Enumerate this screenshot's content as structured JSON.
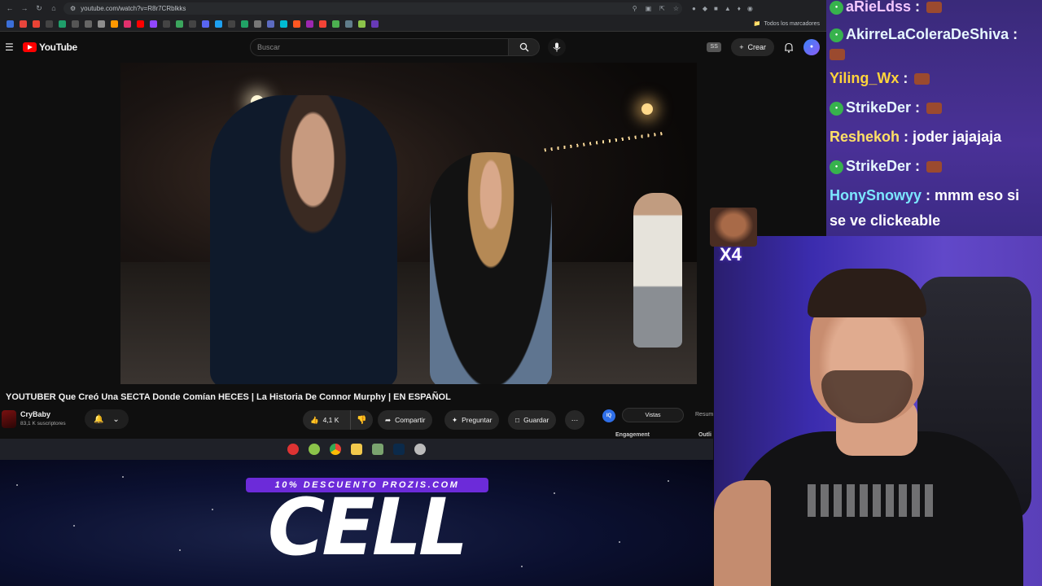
{
  "browser": {
    "url": "youtube.com/watch?v=R8r7CRblkks",
    "bookmarks_all_label": "Todos los marcadores"
  },
  "youtube": {
    "logo_text": "YouTube",
    "search_placeholder": "Buscar",
    "ss_badge": "SS",
    "create_label": "Crear",
    "video_title": "YOUTUBER Que Creó Una SECTA Donde Comían HECES | La Historia De Connor Murphy | EN ESPAÑOL",
    "channel_name": "CryBaby",
    "channel_subs": "83,1 K suscriptores",
    "like_count": "4,1 K",
    "share_label": "Compartir",
    "ask_label": "Preguntar",
    "save_label": "Guardar",
    "side_panel": {
      "icon_text": "IQ",
      "tab_active": "Vistas",
      "tab_2": "Resum",
      "label_1": "Engagement",
      "label_2": "Outli"
    }
  },
  "overlay": {
    "promo_banner": "10% DESCUENTO PROZIS.COM",
    "promo_word": "CELL",
    "emote_count": "X4"
  },
  "chat": {
    "messages": [
      {
        "user": "aRieLdss",
        "text": "",
        "badge": true,
        "emote": true
      },
      {
        "user": "AkirreLaColeraDeShiva",
        "text": "",
        "badge": true,
        "emote": false
      },
      {
        "user": "Yiling_Wx",
        "text": "",
        "badge": false,
        "emote": true
      },
      {
        "user": "StrikeDer",
        "text": "",
        "badge": true,
        "emote": true
      },
      {
        "user": "Reshekoh",
        "text": "joder jajajaja",
        "badge": false,
        "emote": false
      },
      {
        "user": "StrikeDer",
        "text": "",
        "badge": true,
        "emote": true
      },
      {
        "user": "HonySnowyy",
        "text": "mmm eso si",
        "badge": false,
        "emote": false
      },
      {
        "user": "",
        "text": "se ve clickeable",
        "badge": false,
        "emote": false
      }
    ]
  },
  "colors": {
    "youtube_red": "#ff0000",
    "promo_purple": "#6c2bd9",
    "chat_bg": "#4a3197"
  }
}
